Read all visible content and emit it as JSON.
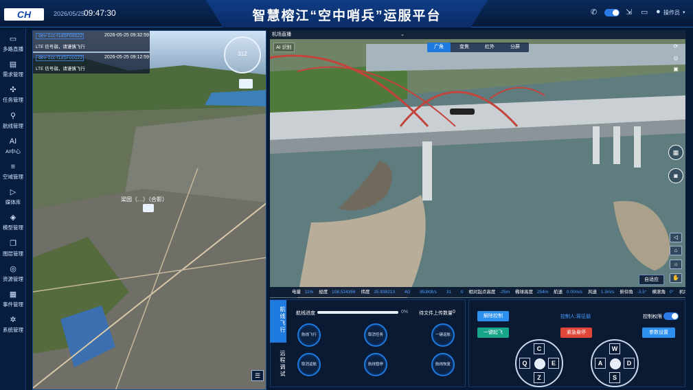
{
  "header": {
    "logo_text": "CH",
    "date": "2026/05/25",
    "time": "09:47:30",
    "title": "智慧榕江“空中哨兵”运服平台",
    "user": "操作员"
  },
  "sidebar": {
    "items": [
      {
        "label": "多路直播",
        "icon": "▭"
      },
      {
        "label": "需求管理",
        "icon": "▤"
      },
      {
        "label": "任务管理",
        "icon": "✣"
      },
      {
        "label": "航线管理",
        "icon": "⚲"
      },
      {
        "label": "AI中心",
        "icon": "AI"
      },
      {
        "label": "空域管理",
        "icon": "≡"
      },
      {
        "label": "媒体库",
        "icon": "▷"
      },
      {
        "label": "模型管理",
        "icon": "◈"
      },
      {
        "label": "图层管理",
        "icon": "❐"
      },
      {
        "label": "资源管理",
        "icon": "◎"
      },
      {
        "label": "事件管理",
        "icon": "▦"
      },
      {
        "label": "系统管理",
        "icon": "✲"
      }
    ]
  },
  "map": {
    "notices": [
      {
        "id": "dev-1cc-f1d5F00022",
        "time": "2026-05-25 09:32:59",
        "msg": "LTE 信号弱，请谨慎飞行"
      },
      {
        "id": "dev-1cc-f1d5F00022",
        "time": "2026-05-25 09:12:59",
        "msg": "LTE 信号弱，请谨慎飞行"
      }
    ],
    "compass_value": "312",
    "place_label": "梁园（…）（合影）"
  },
  "video": {
    "title": "机场直播",
    "ai_label": "AI 识别",
    "tabs": [
      "广角",
      "变焦",
      "红外",
      "分屏"
    ],
    "active_tab": "广角",
    "fit_button": "自适应"
  },
  "telemetry": [
    {
      "label": "电量",
      "value": "11%"
    },
    {
      "label": "经度",
      "value": "108.524356"
    },
    {
      "label": "纬度",
      "value": "25.938213"
    },
    {
      "label": "",
      "value": "4G"
    },
    {
      "label": "",
      "value": "853KB/s"
    },
    {
      "label": "",
      "value": "31"
    },
    {
      "label": "",
      "value": "0"
    },
    {
      "label": "相对起点高度",
      "value": "-25m"
    },
    {
      "label": "椭球高度",
      "value": "254m"
    },
    {
      "label": "航速",
      "value": "0.00m/s"
    },
    {
      "label": "风速",
      "value": "1.3m/s"
    },
    {
      "label": "俯仰角",
      "value": "-3.5°"
    },
    {
      "label": "横滚角",
      "value": "0°"
    },
    {
      "label": "机场状态",
      "value": "作业中"
    }
  ],
  "mission": {
    "tab_flight": "航线飞行",
    "tab_debug": "远程调试",
    "progress_label": "航线进度",
    "progress_value": "0%",
    "progress_fraction": 0,
    "upload_label": "待文件上传数量",
    "upload_count": "0",
    "buttons": [
      "航线飞行",
      "取消任务",
      "一键返航",
      "取消返航",
      "航线暂停",
      "航线恢复"
    ]
  },
  "control": {
    "release_button": "解除控制",
    "takeoff_button": "一键起飞",
    "controller": "控制人:蒋征朋",
    "emergency_button": "紧急悬停",
    "authority_label": "控制权限",
    "params_button": "参数设置",
    "left_pad": {
      "up": "C",
      "down": "Z",
      "left": "Q",
      "right": "E"
    },
    "right_pad": {
      "up": "W",
      "down": "S",
      "left": "A",
      "right": "D"
    }
  }
}
